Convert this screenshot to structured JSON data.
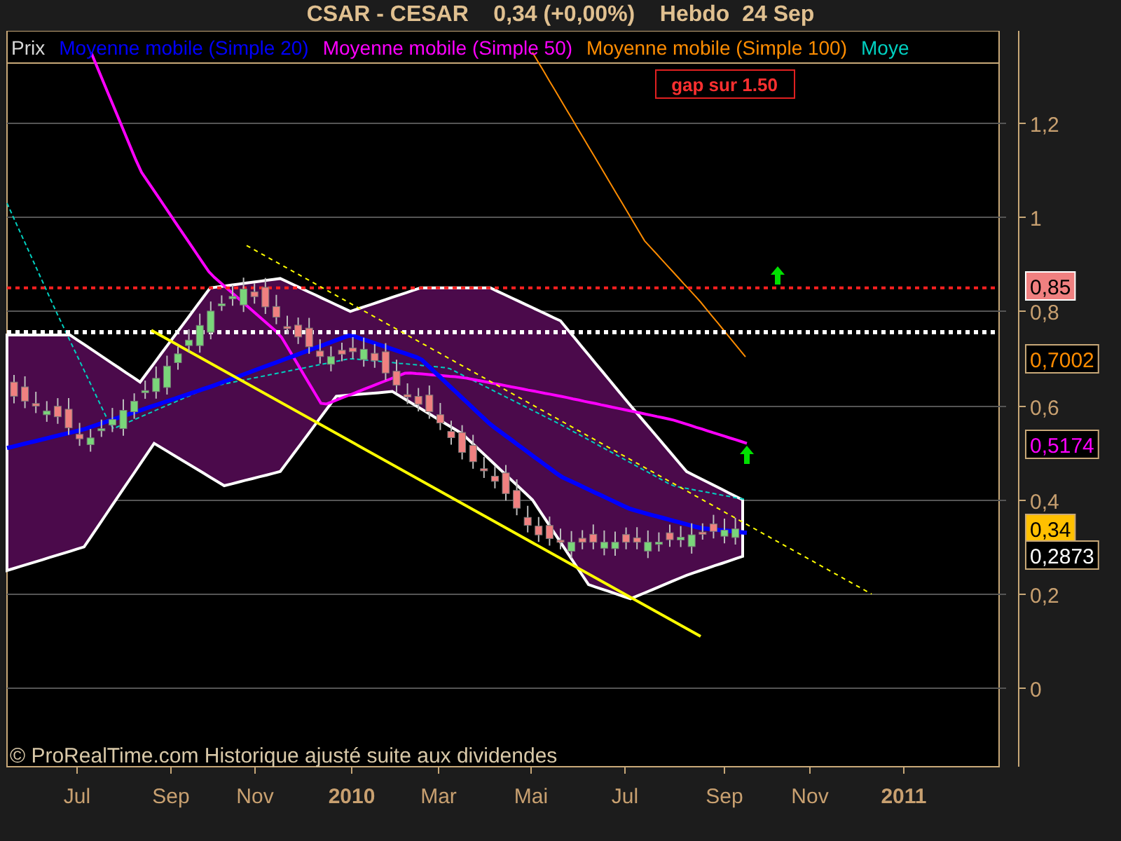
{
  "title": {
    "symbol": "CSAR - CESAR",
    "quote": "0,34 (+0,00%)",
    "period": "Hebdo",
    "date": "24 Sep"
  },
  "legend": [
    {
      "label": "Prix",
      "color": "#d8d8d8"
    },
    {
      "label": "Moyenne mobile (Simple 20)",
      "color": "#0000ff"
    },
    {
      "label": "Moyenne mobile (Simple 50)",
      "color": "#ff00ff"
    },
    {
      "label": "Moyenne mobile (Simple 100)",
      "color": "#ff8c00"
    },
    {
      "label": "Moye",
      "color": "#00d0c0"
    }
  ],
  "annotation": "gap sur 1.50",
  "y_axis": [
    "1,2",
    "1",
    "0,8",
    "0,6",
    "0,4",
    "0,2",
    "0"
  ],
  "value_labels": [
    {
      "text": "0,85",
      "kind": "line"
    },
    {
      "text": "0,7002",
      "kind": "ma100"
    },
    {
      "text": "0,5174",
      "kind": "ma50"
    },
    {
      "text": "0,34",
      "kind": "price"
    },
    {
      "text": "0,2873",
      "kind": "lower"
    }
  ],
  "x_axis": [
    {
      "label": "Jul",
      "year": false
    },
    {
      "label": "Sep",
      "year": false
    },
    {
      "label": "Nov",
      "year": false
    },
    {
      "label": "2010",
      "year": true
    },
    {
      "label": "Mar",
      "year": false
    },
    {
      "label": "Mai",
      "year": false
    },
    {
      "label": "Jul",
      "year": false
    },
    {
      "label": "Sep",
      "year": false
    },
    {
      "label": "Nov",
      "year": false
    },
    {
      "label": "2011",
      "year": true
    }
  ],
  "footer": "© ProRealTime.com Historique ajusté suite aux dividendes"
}
